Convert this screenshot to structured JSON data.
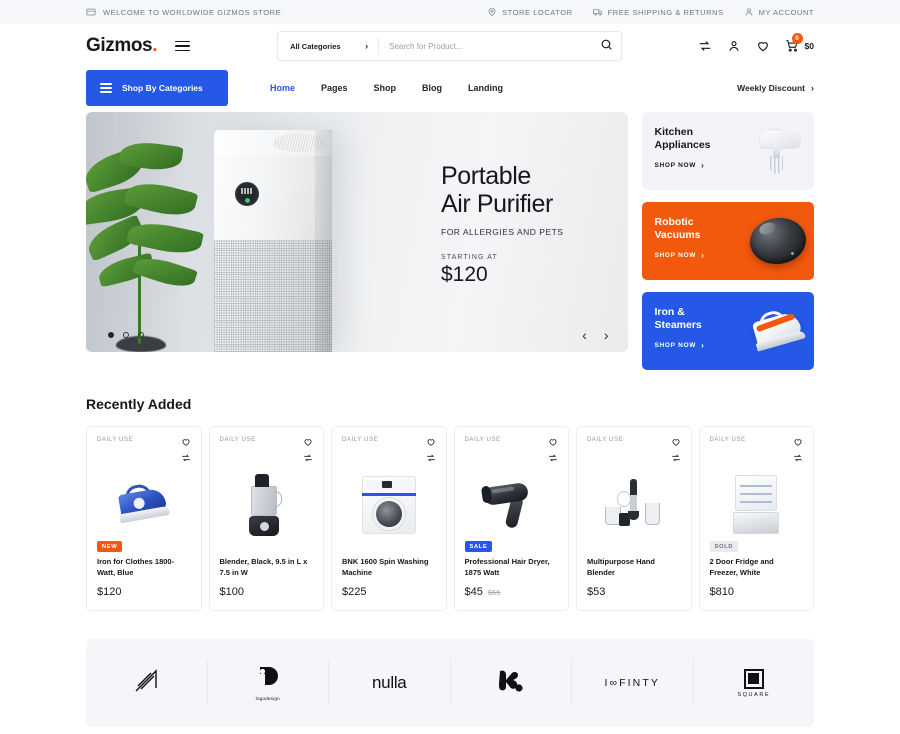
{
  "topbar": {
    "welcome": "WELCOME TO WORLDWIDE GIZMOS STORE",
    "welcome_icon": "card-icon",
    "links": [
      {
        "label": "STORE LOCATOR",
        "icon": "location-pin-icon"
      },
      {
        "label": "FREE SHIPPING & RETURNS",
        "icon": "truck-icon"
      },
      {
        "label": "MY ACCOUNT",
        "icon": "user-icon"
      }
    ]
  },
  "header": {
    "logo_text": "Gizmos",
    "logo_dot": ".",
    "menu_icon": "hamburger-icon",
    "search": {
      "category_label": "All Categories",
      "category_chevron": "›",
      "placeholder": "Search for Product...",
      "value": "",
      "search_icon": "magnifier-icon"
    },
    "actions": [
      {
        "name": "compare-icon"
      },
      {
        "name": "account-icon"
      },
      {
        "name": "wishlist-heart-icon"
      }
    ],
    "cart": {
      "icon": "cart-icon",
      "count": "0",
      "total": "$0"
    }
  },
  "nav": {
    "shop_categories": "Shop By Categories",
    "links": [
      {
        "label": "Home",
        "active": true
      },
      {
        "label": "Pages",
        "active": false
      },
      {
        "label": "Shop",
        "active": false
      },
      {
        "label": "Blog",
        "active": false
      },
      {
        "label": "Landing",
        "active": false
      }
    ],
    "weekly_discount": "Weekly Discount",
    "weekly_chevron": "›"
  },
  "hero": {
    "title_line1": "Portable",
    "title_line2": "Air Purifier",
    "subtitle": "FOR ALLERGIES AND PETS",
    "starting_label": "STARTING AT",
    "price": "$120",
    "dots": [
      "active",
      "inactive",
      "inactive"
    ],
    "prev_arrow": "‹",
    "next_arrow": "›"
  },
  "category_cards": [
    {
      "title_line1": "Kitchen",
      "title_line2": "Appliances",
      "cta": "SHOP NOW",
      "chevron": "›",
      "style": "light",
      "art": "stand-mixer-icon",
      "color": "#f2f4f9"
    },
    {
      "title_line1": "Robotic",
      "title_line2": "Vacuums",
      "cta": "SHOP NOW",
      "chevron": "›",
      "style": "orange",
      "art": "robot-vacuum-icon",
      "color": "#f2590c"
    },
    {
      "title_line1": "Iron &",
      "title_line2": "Steamers",
      "cta": "SHOP NOW",
      "chevron": "›",
      "style": "blue",
      "art": "iron-icon",
      "color": "#2558e6"
    }
  ],
  "recently_added": {
    "title": "Recently Added",
    "products": [
      {
        "tag": "DAILY USE",
        "badge": "NEW",
        "badge_style": "new",
        "name": "Iron for Clothes 1800-Watt, Blue",
        "price": "$120",
        "old_price": "",
        "art": "clothes-iron-blue-image"
      },
      {
        "tag": "DAILY USE",
        "badge": "",
        "badge_style": "",
        "name": "Blender, Black, 9.5 in L x 7.5 in W",
        "price": "$100",
        "old_price": "",
        "art": "blender-black-image"
      },
      {
        "tag": "DAILY USE",
        "badge": "",
        "badge_style": "",
        "name": "BNK 1600 Spin Washing Machine",
        "price": "$225",
        "old_price": "",
        "art": "washing-machine-image"
      },
      {
        "tag": "DAILY USE",
        "badge": "SALE",
        "badge_style": "sale",
        "name": "Professional Hair Dryer, 1875 Watt",
        "price": "$45",
        "old_price": "$65",
        "art": "hair-dryer-image"
      },
      {
        "tag": "DAILY USE",
        "badge": "",
        "badge_style": "",
        "name": "Multipurpose Hand Blender",
        "price": "$53",
        "old_price": "",
        "art": "hand-blender-image"
      },
      {
        "tag": "DAILY USE",
        "badge": "SOLD",
        "badge_style": "sold",
        "name": "2 Door Fridge and Freezer, White",
        "price": "$810",
        "old_price": "",
        "art": "fridge-freezer-image"
      }
    ],
    "card_icons": {
      "wishlist": "heart-icon",
      "compare": "compare-arrows-icon"
    }
  },
  "brands": [
    {
      "name": "diagonal-lines-logo",
      "text": ""
    },
    {
      "name": "logodesign-logo",
      "text": "logodesign"
    },
    {
      "name": "nulla-logo",
      "text": "nulla"
    },
    {
      "name": "blob-m-logo",
      "text": ""
    },
    {
      "name": "infinty-logo",
      "text": "I∞FINTY"
    },
    {
      "name": "square-logo",
      "text": "SQUARE"
    }
  ],
  "colors": {
    "accent_orange": "#f2590c",
    "accent_blue": "#2558e6",
    "topbar_bg": "#f6f7fb",
    "brands_bg": "#f4f6fa"
  }
}
